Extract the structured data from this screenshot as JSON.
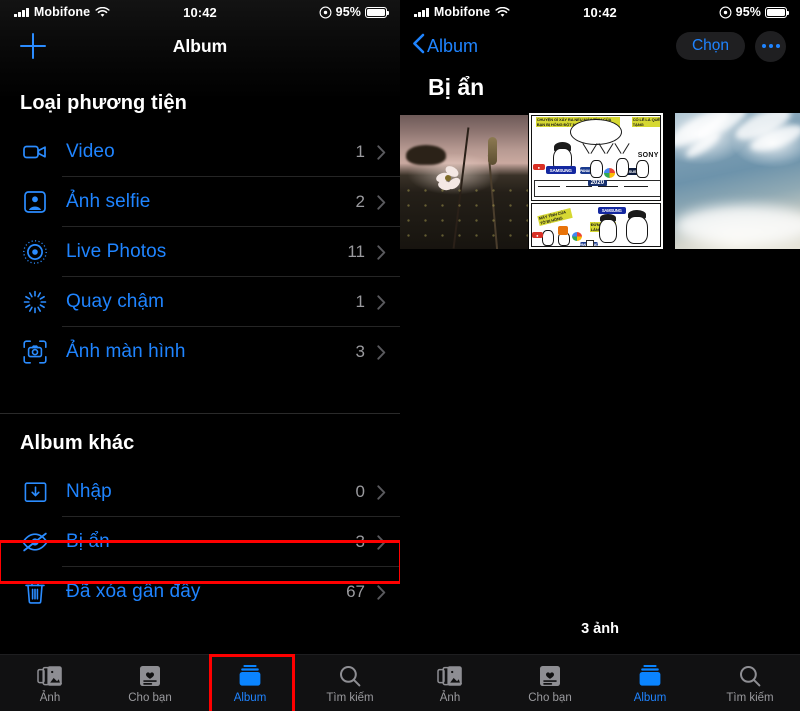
{
  "status_bar": {
    "carrier": "Mobifone",
    "time": "10:42",
    "battery_percent": "95%",
    "signal_icon": "cellular-bars-icon",
    "wifi_icon": "wifi-icon",
    "orientation_lock_icon": "rotation-lock-icon",
    "battery_icon": "battery-icon"
  },
  "left_panel": {
    "nav": {
      "add_icon": "plus-icon",
      "title": "Album"
    },
    "sections": [
      {
        "header": "Loại phương tiện",
        "items": [
          {
            "icon": "video-camera-icon",
            "label": "Video",
            "count": "1",
            "chevron": "chevron-right-icon"
          },
          {
            "icon": "selfie-person-icon",
            "label": "Ảnh selfie",
            "count": "2",
            "chevron": "chevron-right-icon"
          },
          {
            "icon": "live-photos-icon",
            "label": "Live Photos",
            "count": "11",
            "chevron": "chevron-right-icon"
          },
          {
            "icon": "slow-motion-icon",
            "label": "Quay chậm",
            "count": "1",
            "chevron": "chevron-right-icon"
          },
          {
            "icon": "screenshot-icon",
            "label": "Ảnh màn hình",
            "count": "3",
            "chevron": "chevron-right-icon"
          }
        ]
      },
      {
        "header": "Album khác",
        "items": [
          {
            "icon": "import-download-icon",
            "label": "Nhập",
            "count": "0",
            "chevron": "chevron-right-icon"
          },
          {
            "icon": "eye-slash-hidden-icon",
            "label": "Bị ẩn",
            "count": "3",
            "chevron": "chevron-right-icon"
          },
          {
            "icon": "trash-icon",
            "label": "Đã xóa gần đây",
            "count": "67",
            "chevron": "chevron-right-icon"
          }
        ]
      }
    ],
    "tabs": [
      {
        "icon": "photos-stack-icon",
        "label": "Ảnh",
        "active": false
      },
      {
        "icon": "for-you-heart-icon",
        "label": "Cho bạn",
        "active": false
      },
      {
        "icon": "albums-folder-icon",
        "label": "Album",
        "active": true
      },
      {
        "icon": "search-magnifier-icon",
        "label": "Tìm kiếm",
        "active": false
      }
    ]
  },
  "right_panel": {
    "nav": {
      "back_icon": "chevron-left-icon",
      "back_label": "Album",
      "select_label": "Chọn",
      "more_icon": "ellipsis-icon"
    },
    "title": "Bị ẩn",
    "photos": [
      {
        "name": "photo-flower-field-dusk"
      },
      {
        "name": "photo-comic-meme-brands"
      },
      {
        "name": "photo-sky-clouds"
      }
    ],
    "count_label": "3 ảnh",
    "tabs": [
      {
        "icon": "photos-stack-icon",
        "label": "Ảnh",
        "active": false
      },
      {
        "icon": "for-you-heart-icon",
        "label": "Cho bạn",
        "active": false
      },
      {
        "icon": "albums-folder-icon",
        "label": "Album",
        "active": true
      },
      {
        "icon": "search-magnifier-icon",
        "label": "Tìm kiếm",
        "active": false
      }
    ]
  },
  "annotations": {
    "highlight_color": "#ff0000",
    "boxes": [
      {
        "name": "highlight-hidden-album-row"
      },
      {
        "name": "highlight-album-tab"
      }
    ]
  },
  "colors": {
    "accent_blue": "#1f84ff",
    "background": "#000000",
    "tabbar": "#111112",
    "inactive_gray": "#9a9a9e"
  },
  "comic": {
    "brands": [
      "SAMSUNG",
      "SONY",
      "ASUS",
      "2020"
    ]
  }
}
